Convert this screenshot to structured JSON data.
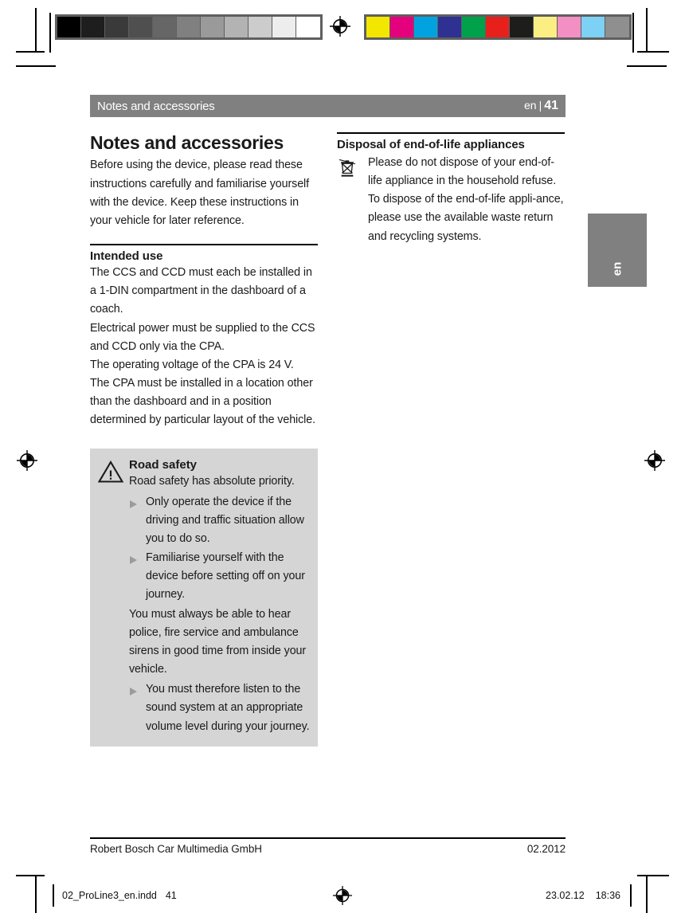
{
  "proof": {
    "gray_strip": {
      "name": "grayscale-calibration-strip",
      "patches": [
        "#000000",
        "#1e1e1e",
        "#3a3a3a",
        "#4f4f4f",
        "#666666",
        "#808080",
        "#9a9a9a",
        "#b3b3b3",
        "#cccccc",
        "#ededed",
        "#ffffff"
      ]
    },
    "color_strip": {
      "name": "color-calibration-strip",
      "patches": [
        "#f3e600",
        "#e5007d",
        "#00a3e0",
        "#2e3192",
        "#00a14b",
        "#e8201b",
        "#1d1d1b",
        "#fbef84",
        "#f390c3",
        "#7cd1f4",
        "#8f8f8f"
      ]
    },
    "registration_mark": "registration-target"
  },
  "header": {
    "title": "Notes and accessories",
    "language": "en",
    "separator": "|",
    "page_number": "41",
    "background": "#808080",
    "text_color": "#ffffff"
  },
  "left_column": {
    "doc_title": "Notes and accessories",
    "intro": "Before using the device, please read these instructions carefully and familiarise yourself with the device. Keep these instructions in your vehicle for later reference.",
    "intended_use": {
      "heading": "Intended use",
      "paragraphs": [
        "The CCS and CCD must each be installed in a 1-DIN compartment in the dashboard of a coach.",
        "Electrical power must be supplied to the CCS and CCD only via the CPA.",
        "The operating voltage of the CPA is 24 V.",
        "The CPA must be installed in a location other than the dashboard and in a position determined by particular layout of the vehicle."
      ]
    },
    "warning_box": {
      "icon": "warning-triangle-icon",
      "heading": "Road safety",
      "lead": "Road safety has absolute priority.",
      "bullets_first": [
        "Only operate the device if the driving and traffic situation allow you to do so.",
        "Familiarise yourself with the device before setting off on your journey."
      ],
      "middle_paragraph": "You must always be able to hear police, fire service and ambulance sirens in good time from inside your vehicle.",
      "bullets_last": [
        "You must therefore listen to the sound system at an appropriate volume level during your journey."
      ],
      "background": "#d5d5d5"
    }
  },
  "right_column": {
    "disposal": {
      "heading": "Disposal of end-of-life appliances",
      "icon": "crossed-out-wheelie-bin-icon",
      "paragraphs": [
        "Please do not dispose of your end-of-life appliance in the household refuse.",
        "To dispose of the end-of-life appli-ance, please use the available waste return and recycling systems."
      ]
    }
  },
  "language_tab": {
    "label": "en",
    "background": "#808080"
  },
  "footer": {
    "company": "Robert Bosch Car Multimedia GmbH",
    "date": "02.2012"
  },
  "imposition": {
    "filename": "02_ProLine3_en.indd",
    "page": "41",
    "date": "23.02.12",
    "time": "18:36"
  }
}
